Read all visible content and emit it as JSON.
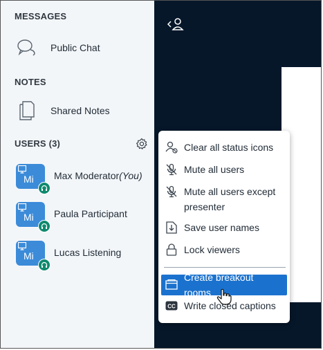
{
  "sidebar": {
    "messages_title": "MESSAGES",
    "public_chat_label": "Public Chat",
    "notes_title": "NOTES",
    "shared_notes_label": "Shared Notes",
    "users_title": "USERS (3)",
    "users": [
      {
        "initials": "Mi",
        "name": "Max Moderator",
        "suffix": "(You)"
      },
      {
        "initials": "Mi",
        "name": "Paula Participant",
        "suffix": ""
      },
      {
        "initials": "Mi",
        "name": "Lucas Listening",
        "suffix": ""
      }
    ]
  },
  "menu": {
    "items": [
      {
        "label": "Clear all status icons",
        "icon": "clear-status-icon"
      },
      {
        "label": "Mute all users",
        "icon": "mic-off-icon"
      },
      {
        "label": "Mute all users except presenter",
        "icon": "mic-off-icon"
      },
      {
        "label": "Save user names",
        "icon": "download-icon"
      },
      {
        "label": "Lock viewers",
        "icon": "lock-icon"
      },
      {
        "label": "Create breakout rooms",
        "icon": "breakout-rooms-icon"
      },
      {
        "label": "Write closed captions",
        "icon": "closed-captions-icon"
      }
    ],
    "active_index": 5
  },
  "colors": {
    "accent": "#1b72ce",
    "avatar": "#3b8bd9",
    "audio": "#0f8a6e",
    "main_bg": "#06172a",
    "sidebar_bg": "#f3f6f9"
  }
}
